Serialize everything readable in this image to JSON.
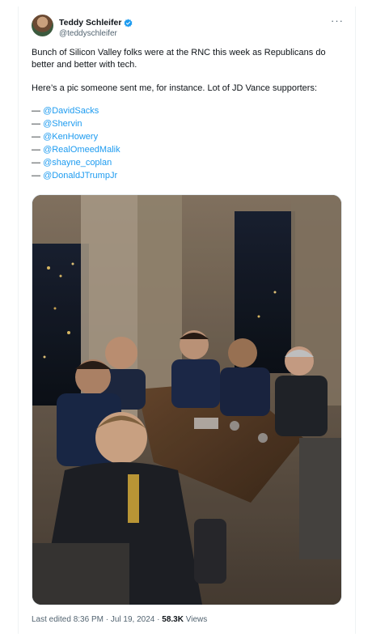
{
  "author": {
    "display_name": "Teddy Schleifer",
    "handle": "@teddyschleifer",
    "verified_icon": "verified-badge-icon",
    "accent_color": "#1d9bf0"
  },
  "more_label": "···",
  "tweet": {
    "paragraph1": "Bunch of Silicon Valley folks were at the RNC this week as Republicans do better and better with tech.",
    "paragraph2": "Here’s a pic someone sent me, for instance. Lot of JD Vance supporters:",
    "dash": "—",
    "mentions": [
      "@DavidSacks",
      "@Shervin",
      "@KenHowery",
      "@RealOmeedMalik",
      "@shayne_coplan",
      "@DonaldJTrumpJr"
    ]
  },
  "meta": {
    "edited": "Last edited 8:36 PM",
    "separator": "·",
    "date": "Jul 19, 2024",
    "views_count": "58.3K",
    "views_label": "Views"
  }
}
